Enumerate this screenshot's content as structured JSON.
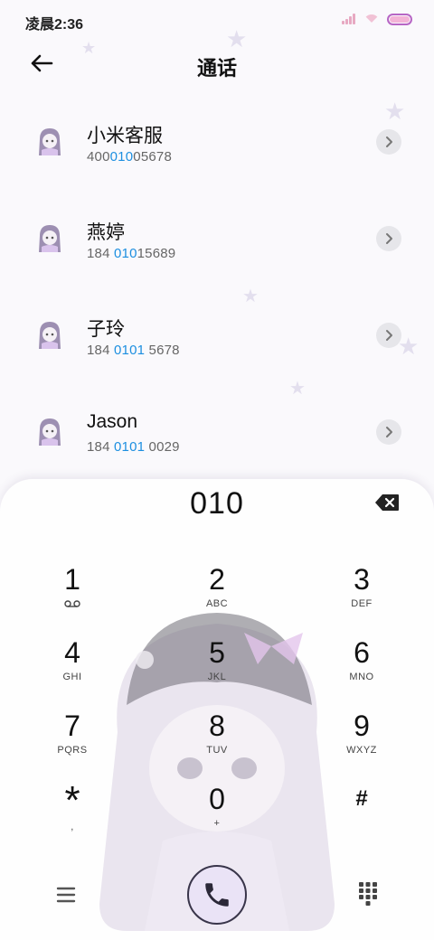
{
  "status_bar": {
    "time": "凌晨2:36",
    "icons": [
      "signal-icon",
      "wifi-icon",
      "battery-icon"
    ],
    "battery_color": "#b766c5"
  },
  "header": {
    "back_icon": "arrow-left-icon",
    "title": "通话"
  },
  "contacts": [
    {
      "name": "小米客服",
      "number_pre": "400",
      "number_hl": "010",
      "number_post": "05678"
    },
    {
      "name": "燕婷",
      "number_pre": "184 ",
      "number_hl": "010",
      "number_post": "15689"
    },
    {
      "name": "子玲",
      "number_pre": "184 ",
      "number_hl": "0101",
      "number_post": " 5678"
    },
    {
      "name": "Jason",
      "number_pre": "184 ",
      "number_hl": "0101",
      "number_post": " 0029"
    }
  ],
  "dialer": {
    "dialed_number": "010",
    "backspace_icon": "backspace-icon",
    "keys": [
      {
        "digit": "1",
        "letters": "",
        "icon": "voicemail-icon"
      },
      {
        "digit": "2",
        "letters": "ABC"
      },
      {
        "digit": "3",
        "letters": "DEF"
      },
      {
        "digit": "4",
        "letters": "GHI"
      },
      {
        "digit": "5",
        "letters": "JKL"
      },
      {
        "digit": "6",
        "letters": "MNO"
      },
      {
        "digit": "7",
        "letters": "PQRS"
      },
      {
        "digit": "8",
        "letters": "TUV"
      },
      {
        "digit": "9",
        "letters": "WXYZ"
      },
      {
        "digit": "*",
        "letters": ","
      },
      {
        "digit": "0",
        "letters": "+"
      },
      {
        "digit": "#",
        "letters": ""
      }
    ],
    "bottom": {
      "menu_icon": "menu-icon",
      "call_icon": "phone-icon",
      "keypad_icon": "keypad-icon"
    }
  },
  "colors": {
    "highlight": "#1d8fe0",
    "star": "#e3dfee",
    "detail_button_bg": "#e6e6ea"
  }
}
